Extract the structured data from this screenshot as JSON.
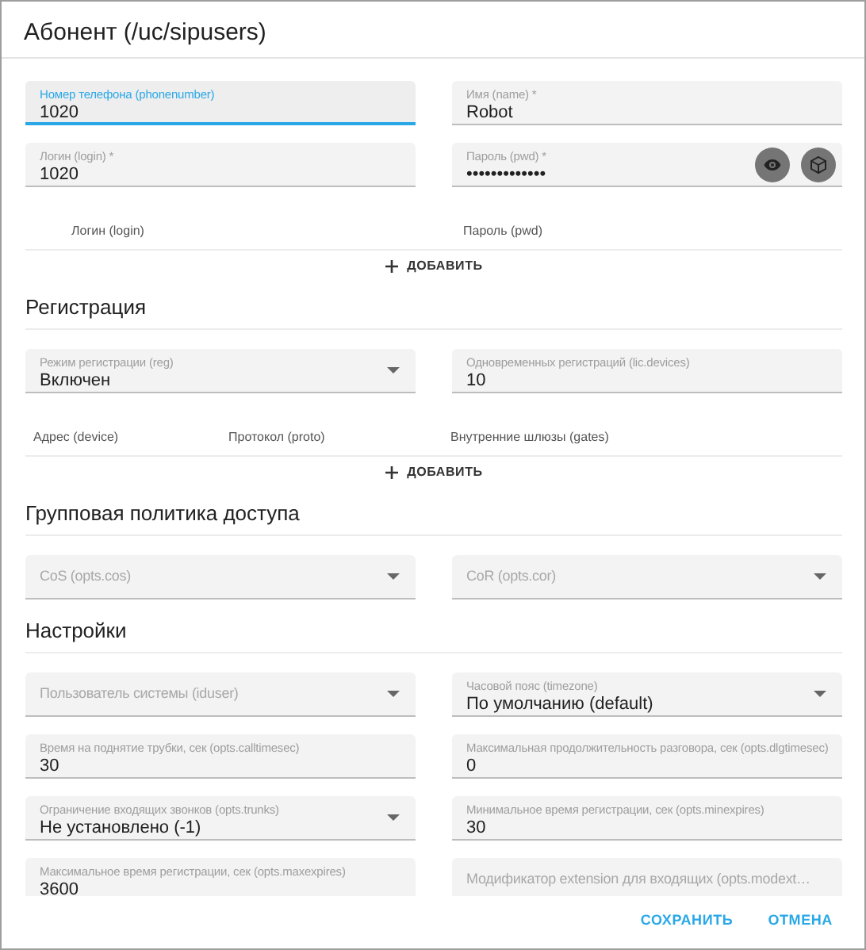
{
  "dialog": {
    "title": "Абонент (/uc/sipusers)"
  },
  "sections": [
    {
      "fields": [
        {
          "kind": "text",
          "label": "Номер телефона (phonenumber)",
          "value": "1020",
          "focused": true
        },
        {
          "kind": "text",
          "label": "Имя (name) *",
          "value": "Robot",
          "focused": false
        },
        {
          "kind": "text",
          "label": "Логин (login) *",
          "value": "1020",
          "focused": false
        },
        {
          "kind": "password",
          "label": "Пароль (pwd) *",
          "value": "•••••••••••••",
          "focused": false
        }
      ],
      "table": {
        "columns": [
          "Логин (login)",
          "Пароль (pwd)"
        ],
        "add_label": "ДОБАВИТЬ"
      }
    },
    {
      "heading": "Регистрация",
      "fields": [
        {
          "kind": "select",
          "label": "Режим регистрации (reg)",
          "value": "Включен",
          "focused": false
        },
        {
          "kind": "text",
          "label": "Одновременных регистраций (lic.devices)",
          "value": "10",
          "focused": false
        }
      ],
      "table": {
        "columns": [
          "Адрес (device)",
          "Протокол (proto)",
          "Внутренние шлюзы (gates)"
        ],
        "add_label": "ДОБАВИТЬ"
      }
    },
    {
      "heading": "Групповая политика доступа",
      "fields": [
        {
          "kind": "select",
          "placeholder": "CoS (opts.cos)",
          "focused": false
        },
        {
          "kind": "select",
          "placeholder": "CoR (opts.cor)",
          "focused": false
        }
      ]
    },
    {
      "heading": "Настройки",
      "fields": [
        {
          "kind": "select",
          "placeholder": "Пользователь системы (iduser)",
          "focused": false
        },
        {
          "kind": "select",
          "label": "Часовой пояс (timezone)",
          "value": "По умолчанию (default)",
          "focused": false
        },
        {
          "kind": "text",
          "label": "Время на поднятие трубки, сек (opts.calltimesec)",
          "value": "30",
          "focused": false
        },
        {
          "kind": "text",
          "label": "Максимальная продолжительность разговора, сек (opts.dlgtimesec)",
          "value": "0",
          "focused": false
        },
        {
          "kind": "select",
          "label": "Ограничение входящих звонков (opts.trunks)",
          "value": "Не установлено (-1)",
          "focused": false
        },
        {
          "kind": "text",
          "label": "Минимальное время регистрации, сек (opts.minexpires)",
          "value": "30",
          "focused": false
        },
        {
          "kind": "text",
          "label": "Максимальное время регистрации, сек (opts.maxexpires)",
          "value": "3600",
          "focused": false
        },
        {
          "kind": "text",
          "placeholder": "Модификатор extension для входящих (opts.modext…",
          "focused": false
        }
      ]
    }
  ],
  "buttons": [
    "СОХРАНИТЬ",
    "ОТМЕНА"
  ]
}
